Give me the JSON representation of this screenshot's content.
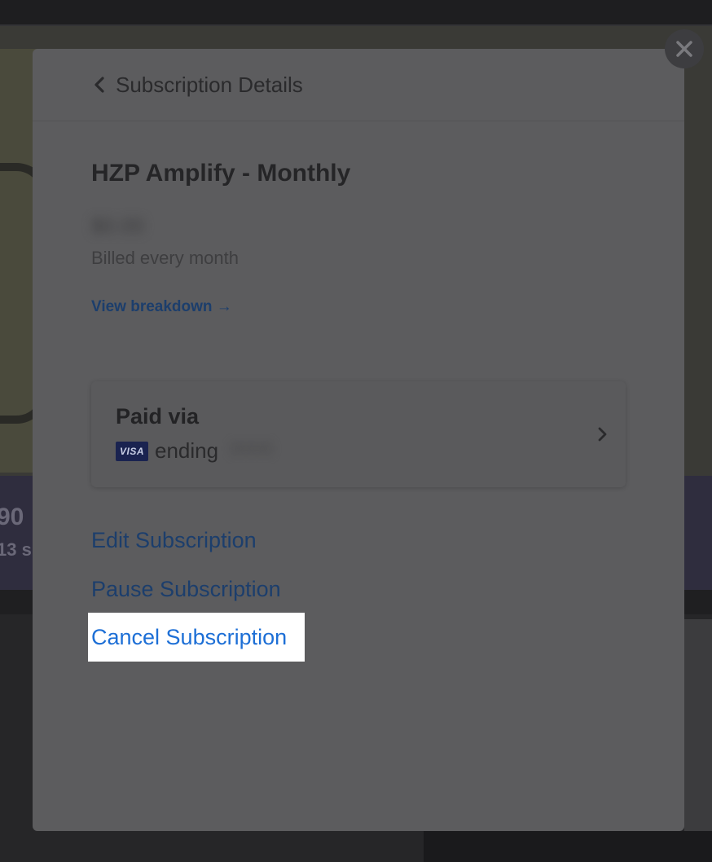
{
  "background": {
    "band_text_1": "90",
    "band_text_2": "13 s"
  },
  "close_button": {
    "icon": "close-icon",
    "glyph": "✕"
  },
  "modal": {
    "header": {
      "back_icon": "chevron-left-icon",
      "title": "Subscription Details"
    },
    "plan": {
      "name": "HZP Amplify - Monthly",
      "price": "$0.00",
      "billing_frequency": "Billed every month",
      "view_breakdown_label": "View breakdown →"
    },
    "payment": {
      "label": "Paid via",
      "card_brand": "VISA",
      "card_icon": "visa-card-icon",
      "ending_label": "ending",
      "last4": "0000",
      "chevron_icon": "chevron-right-icon"
    },
    "actions": {
      "edit_label": "Edit Subscription",
      "pause_label": "Pause Subscription",
      "cancel_label": "Cancel Subscription"
    }
  },
  "colors": {
    "modal_bg": "#5c5c5e",
    "link": "#1c3e6c",
    "highlight_link": "#1d6fd6",
    "highlight_bg": "#ffffff",
    "visa_badge": "#1a2350"
  }
}
